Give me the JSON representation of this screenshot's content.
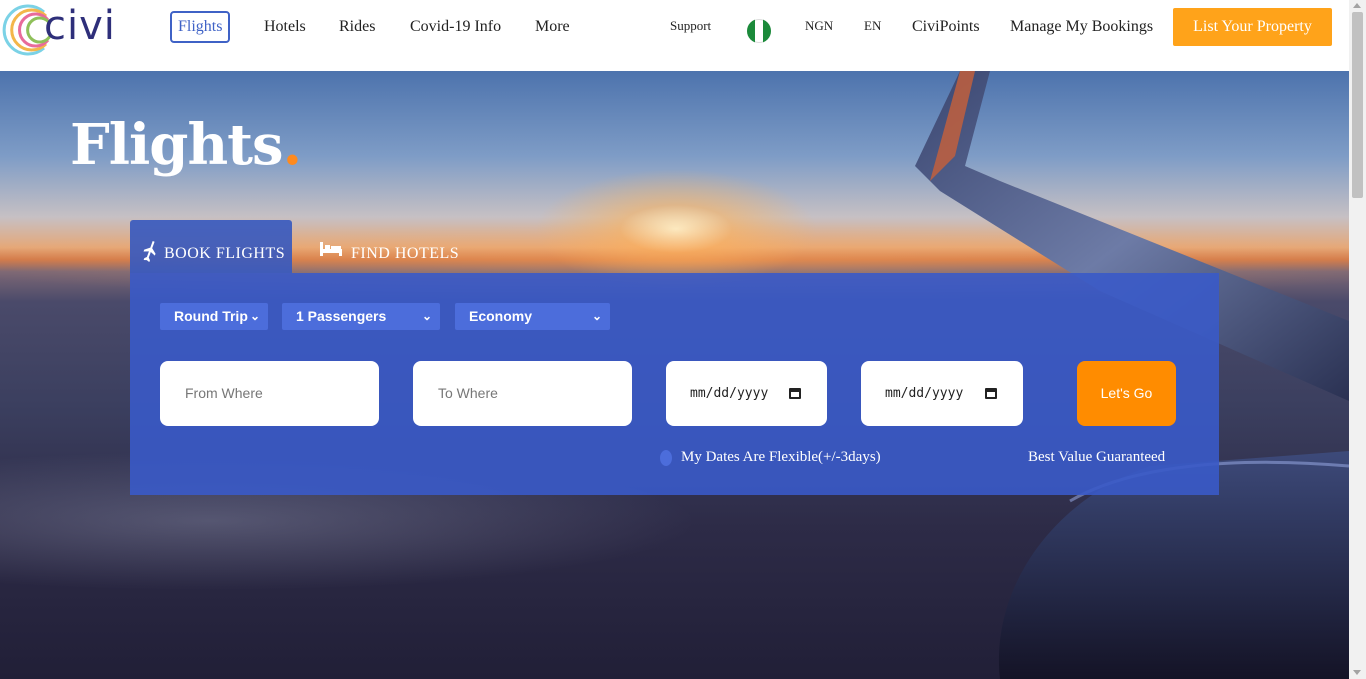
{
  "brand": {
    "logo_text": "civi",
    "logo_icon": "civi-rings-logo-icon"
  },
  "nav": {
    "flights": "Flights",
    "hotels": "Hotels",
    "rides": "Rides",
    "covid": "Covid-19 Info",
    "more": "More"
  },
  "header_right": {
    "support": "Support",
    "country_flag": "nigeria-flag-icon",
    "currency": "NGN",
    "language": "EN",
    "civipoints": "CiviPoints",
    "manage": "Manage My Bookings",
    "list_property": "List Your Property"
  },
  "hero": {
    "title": "Flights",
    "title_dot": "."
  },
  "tabs": {
    "book_flights": "BOOK FLIGHTS",
    "book_flights_icon": "airplane-icon",
    "find_hotels": "FIND HOTELS",
    "find_hotels_icon": "bed-icon"
  },
  "form": {
    "trip_type": "Round Trip",
    "passengers": "1 Passengers",
    "cabin_class": "Economy",
    "from_placeholder": "From Where",
    "to_placeholder": "To Where",
    "depart_date": "mm/dd/yyyy",
    "return_date": "mm/dd/yyyy",
    "submit": "Let's Go",
    "flexible_dates": "My Dates Are Flexible(+/-3days)",
    "best_value": "Best Value Guaranteed"
  },
  "colors": {
    "accent_orange": "#ffa31a",
    "button_orange": "#ff8c00",
    "panel_blue": "#3a5ac8",
    "nav_active": "#3f62c6"
  }
}
